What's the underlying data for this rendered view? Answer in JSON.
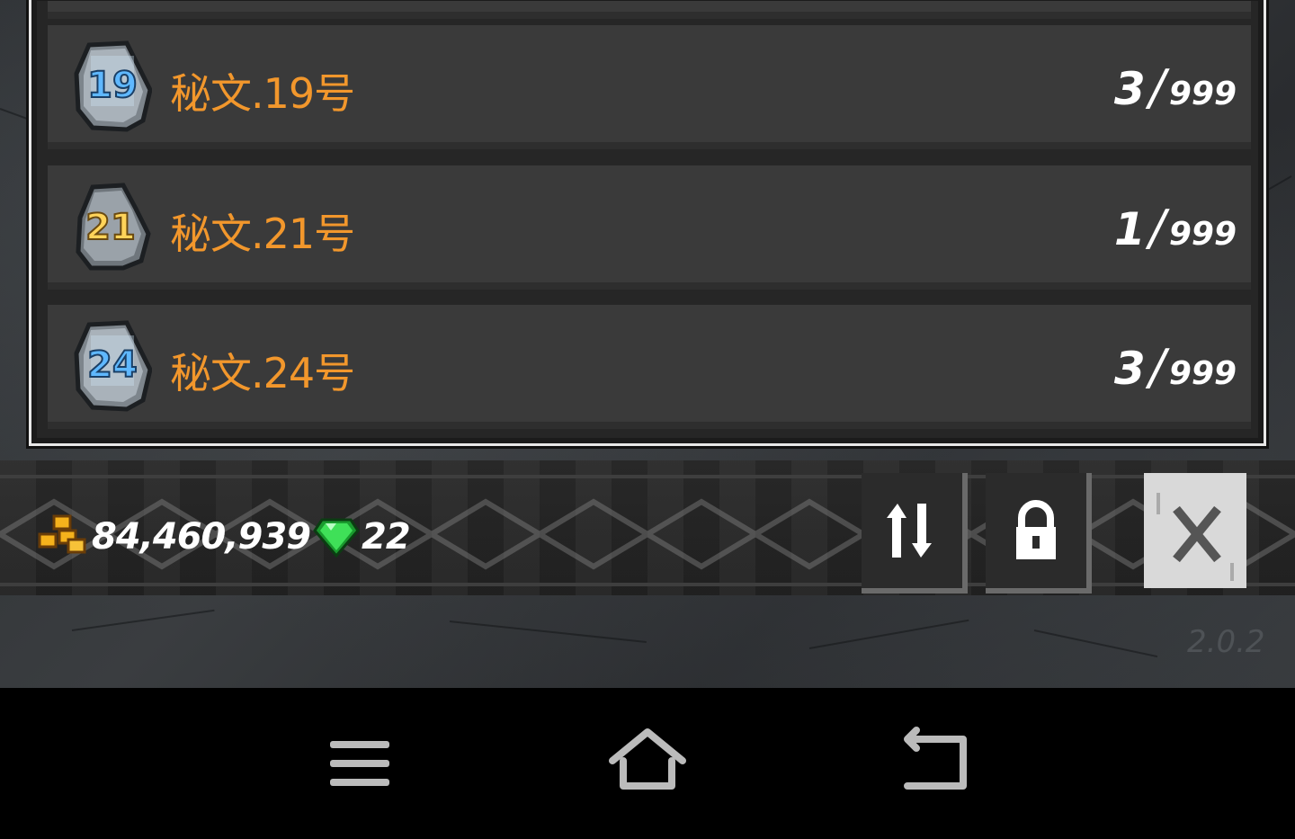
{
  "items": [
    {
      "name": "秘文.19号",
      "rune_number": "19",
      "rune_color": "#5fb8ff",
      "have": "3",
      "separator": "/",
      "max": "999"
    },
    {
      "name": "秘文.21号",
      "rune_number": "21",
      "rune_color": "#ffd45a",
      "have": "1",
      "separator": "/",
      "max": "999"
    },
    {
      "name": "秘文.24号",
      "rune_number": "24",
      "rune_color": "#5fb8ff",
      "have": "3",
      "separator": "/",
      "max": "999"
    }
  ],
  "currency": {
    "gold": "84,460,939",
    "gems": "22"
  },
  "buttons": {
    "sort_icon": "sort-icon",
    "lock_icon": "lock-icon",
    "close_icon": "close-icon"
  },
  "version": "2.0.2",
  "android_nav": {
    "menu_icon": "menu-icon",
    "home_icon": "home-icon",
    "back_icon": "back-icon"
  },
  "colors": {
    "item_name": "#f2972c",
    "count_text": "#ffffff",
    "gem": "#22c93a",
    "gold": "#f5b21c"
  }
}
